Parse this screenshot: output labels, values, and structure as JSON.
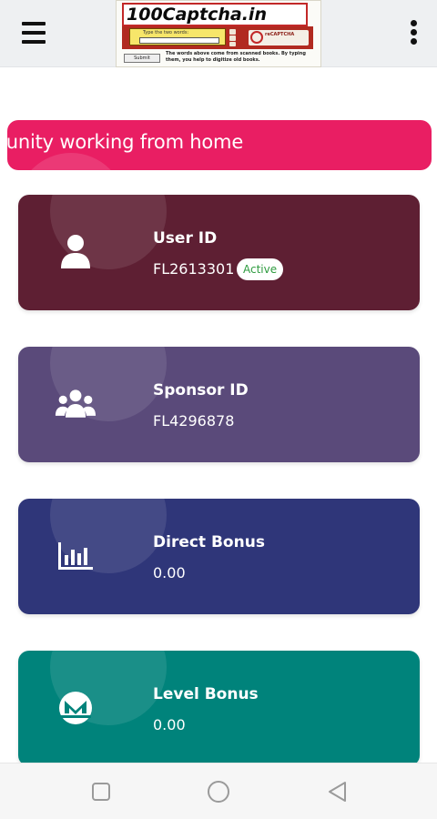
{
  "header": {
    "menu_icon": "hamburger-menu-icon",
    "more_icon": "more-vertical-icon"
  },
  "banner": {
    "title": "100Captcha.in",
    "prompt": "Type the two words:",
    "logo_text": "reCAPTCHA",
    "submit_label": "Submit",
    "note": "The words above come from scanned books. By typing them, you help to digitize old books."
  },
  "marquee": {
    "text": "An easy income opportunity working from home",
    "color": "#e91e63"
  },
  "cards": [
    {
      "title": "User ID",
      "value": "FL2613301",
      "badge": "Active",
      "icon": "user-icon",
      "color": "#5e1f33"
    },
    {
      "title": "Sponsor ID",
      "value": "FL4296878",
      "icon": "users-group-icon",
      "color": "#5a4a7a"
    },
    {
      "title": "Direct Bonus",
      "value": "0.00",
      "icon": "bar-chart-icon",
      "color": "#2f3679"
    },
    {
      "title": "Level Bonus",
      "value": "0.00",
      "icon": "monero-coin-icon",
      "color": "#00837b"
    }
  ],
  "nav": {
    "recents_icon": "square-recents-icon",
    "home_icon": "circle-home-icon",
    "back_icon": "triangle-back-icon"
  }
}
